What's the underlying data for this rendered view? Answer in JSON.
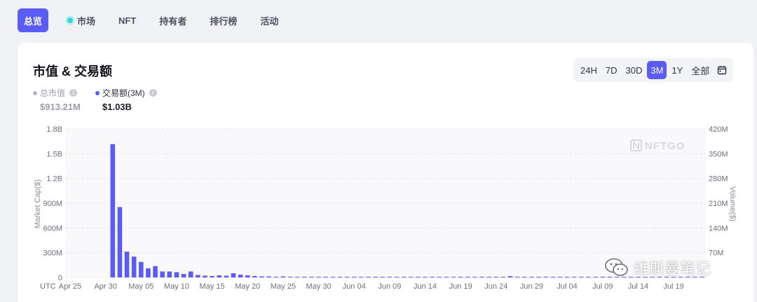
{
  "nav": {
    "items": [
      {
        "label": "总览",
        "active": true
      },
      {
        "label": "市场",
        "active": false,
        "icon": "market-dot-icon"
      },
      {
        "label": "NFT",
        "active": false
      },
      {
        "label": "持有者",
        "active": false
      },
      {
        "label": "排行榜",
        "active": false
      },
      {
        "label": "活动",
        "active": false
      }
    ]
  },
  "card": {
    "title": "市值 & 交易额",
    "ranges": [
      "24H",
      "7D",
      "30D",
      "3M",
      "1Y",
      "全部"
    ],
    "active_range": "3M",
    "calendar_icon": "calendar-icon"
  },
  "legend": {
    "market_cap": {
      "label": "总市值",
      "value": "$913.21M",
      "color": "#b4b7c0"
    },
    "volume": {
      "label": "交易额(3M)",
      "value": "$1.03B",
      "color": "#5b5cf6"
    }
  },
  "watermark": "NFTGO",
  "wechat": {
    "text": "维斯曼笔记",
    "icon": "wechat-icon"
  },
  "colors": {
    "accent": "#5b5cf6",
    "bar": "#5b5cf6"
  },
  "chart_data": {
    "type": "bar",
    "xlabel": "",
    "ylabel": "Market Cap($)",
    "y2label": "Volume($)",
    "ylim": [
      0,
      1800000000
    ],
    "y2lim": [
      0,
      420000000
    ],
    "yticks": [
      "0",
      "300M",
      "600M",
      "900M",
      "1.2B",
      "1.5B",
      "1.8B"
    ],
    "y2ticks": [
      "70M",
      "140M",
      "210M",
      "280M",
      "350M",
      "420M"
    ],
    "xticks": [
      "UTC",
      "Apr 25",
      "Apr 30",
      "May 05",
      "May 10",
      "May 15",
      "May 20",
      "May 25",
      "May 30",
      "Jun 04",
      "Jun 09",
      "Jun 14",
      "Jun 19",
      "Jun 24",
      "Jun 29",
      "Jul 04",
      "Jul 09",
      "Jul 14",
      "Jul 19"
    ],
    "grid": true,
    "series": [
      {
        "name": "交易额(3M)",
        "axis": "right",
        "x": [
          "May 01",
          "May 02",
          "May 03",
          "May 04",
          "May 05",
          "May 06",
          "May 07",
          "May 08",
          "May 09",
          "May 10",
          "May 11",
          "May 12",
          "May 13",
          "May 14",
          "May 15",
          "May 16",
          "May 17",
          "May 18",
          "May 19",
          "May 20",
          "May 21",
          "May 22",
          "May 23",
          "May 24",
          "May 25",
          "May 26",
          "May 27",
          "May 28",
          "May 29",
          "May 30",
          "May 31",
          "Jun 01",
          "Jun 02",
          "Jun 03",
          "Jun 04",
          "Jun 05",
          "Jun 06",
          "Jun 07",
          "Jun 08",
          "Jun 09",
          "Jun 10",
          "Jun 11",
          "Jun 12",
          "Jun 13",
          "Jun 14",
          "Jun 15",
          "Jun 16",
          "Jun 17",
          "Jun 18",
          "Jun 19",
          "Jun 20",
          "Jun 21",
          "Jun 22",
          "Jun 23",
          "Jun 24",
          "Jun 25",
          "Jun 26",
          "Jun 27",
          "Jun 28",
          "Jun 29",
          "Jun 30",
          "Jul 01",
          "Jul 02",
          "Jul 03",
          "Jul 04",
          "Jul 05",
          "Jul 06",
          "Jul 07",
          "Jul 08",
          "Jul 09",
          "Jul 10",
          "Jul 11",
          "Jul 12",
          "Jul 13",
          "Jul 14",
          "Jul 15",
          "Jul 16",
          "Jul 17",
          "Jul 18",
          "Jul 19",
          "Jul 20",
          "Jul 21",
          "Jul 22",
          "Jul 23"
        ],
        "values": [
          377000000,
          199000000,
          73000000,
          59000000,
          44000000,
          26000000,
          32000000,
          17000000,
          17000000,
          15000000,
          10000000,
          17000000,
          7000000,
          5000000,
          4000000,
          6000000,
          5000000,
          12000000,
          8000000,
          6000000,
          4000000,
          3000000,
          3000000,
          2000000,
          3000000,
          2000000,
          2000000,
          2000000,
          1500000,
          1500000,
          1500000,
          1200000,
          1200000,
          1000000,
          1000000,
          1000000,
          800000,
          800000,
          800000,
          1000000,
          800000,
          700000,
          700000,
          700000,
          600000,
          600000,
          600000,
          700000,
          600000,
          500000,
          500000,
          500000,
          500000,
          500000,
          500000,
          600000,
          3500000,
          2000000,
          800000,
          500000,
          500000,
          500000,
          500000,
          500000,
          500000,
          600000,
          800000,
          1500000,
          700000,
          500000,
          500000,
          500000,
          500000,
          500000,
          500000,
          500000,
          500000,
          500000,
          1500000,
          500000,
          500000,
          500000,
          500000,
          500000
        ]
      }
    ]
  }
}
